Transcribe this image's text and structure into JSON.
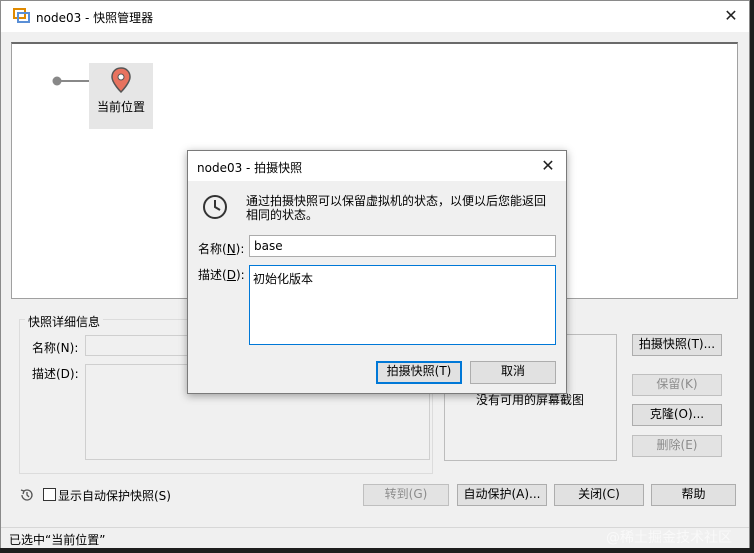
{
  "window": {
    "title": "node03 - 快照管理器",
    "close_glyph": "✕"
  },
  "tree": {
    "current_node_label": "当前位置"
  },
  "details": {
    "group_title": "快照详细信息",
    "name_label": "名称(N):",
    "desc_label": "描述(D):",
    "no_screenshot_text": "没有可用的屏幕截图"
  },
  "right_buttons": {
    "take_snapshot": "拍摄快照(T)...",
    "keep": "保留(K)",
    "clone": "克隆(O)...",
    "delete": "删除(E)"
  },
  "bottom": {
    "show_autoprotect_label": "显示自动保护快照(S)",
    "goto": "转到(G)",
    "autoprotect": "自动保护(A)...",
    "close": "关闭(C)",
    "help": "帮助"
  },
  "status": {
    "text": "已选中“当前位置”"
  },
  "dialog": {
    "title": "node03 - 拍摄快照",
    "close_glyph": "✕",
    "info_text_line1": "通过拍摄快照可以保留虚拟机的状态，以便以后您能返回",
    "info_text_line2": "相同的状态。",
    "name_label_prefix": "名称(",
    "name_label_key": "N",
    "name_label_suffix": "):",
    "name_value": "base",
    "desc_label_prefix": "描述(",
    "desc_label_key": "D",
    "desc_label_suffix": "):",
    "desc_value": "初始化版本",
    "ok_button": "拍摄快照(T)",
    "cancel_button": "取消"
  },
  "watermark": "@稀土掘金技术社区",
  "colors": {
    "accent": "#0078d7",
    "pin": "#e8735f",
    "window_bg": "#f0f0f0"
  }
}
